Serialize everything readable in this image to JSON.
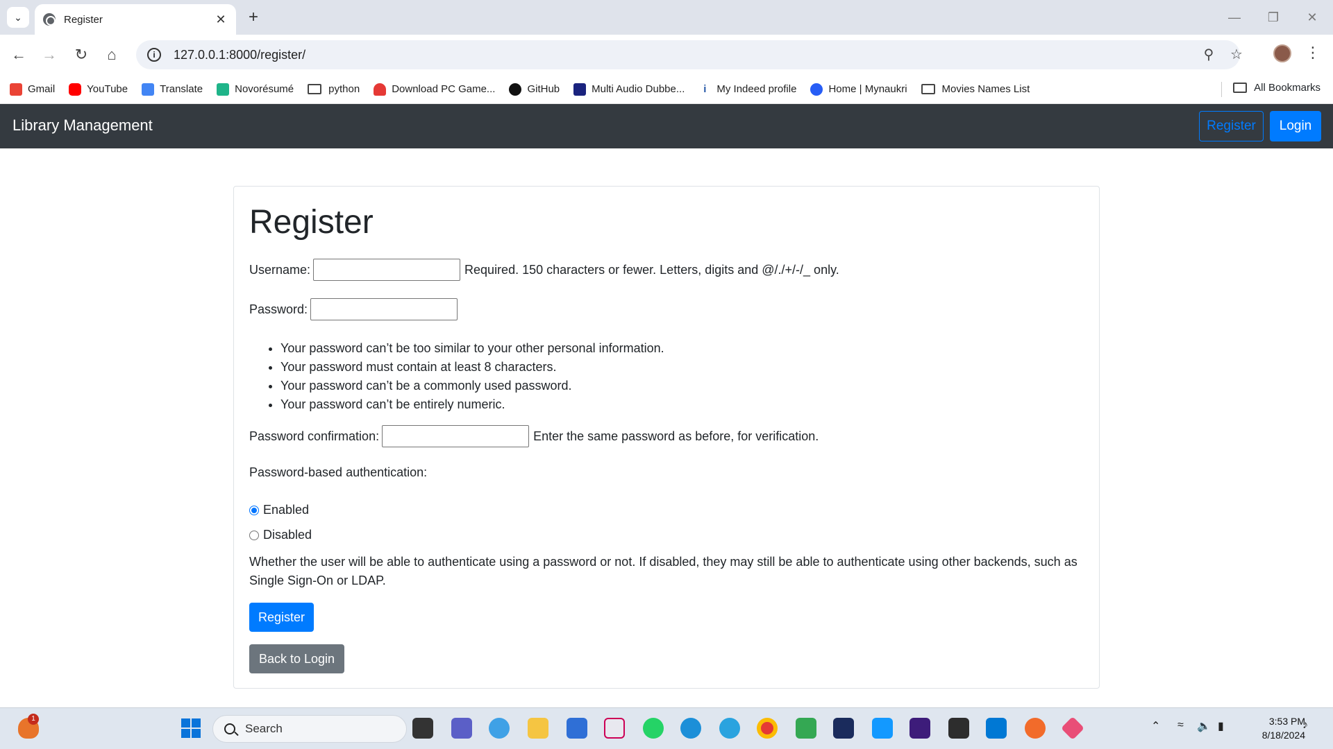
{
  "browser": {
    "tab_title": "Register",
    "url": "127.0.0.1:8000/register/",
    "bookmarks": [
      {
        "label": "Gmail",
        "icon": "gmail-icon",
        "color": "#ea4335"
      },
      {
        "label": "YouTube",
        "icon": "youtube-icon",
        "color": "#ff0000"
      },
      {
        "label": "Translate",
        "icon": "translate-icon",
        "color": "#4285f4"
      },
      {
        "label": "Novorésumé",
        "icon": "novoresume-icon",
        "color": "#1fb489"
      },
      {
        "label": "python",
        "icon": "folder-icon",
        "color": ""
      },
      {
        "label": "Download PC Game...",
        "icon": "game-icon",
        "color": "#e53935"
      },
      {
        "label": "GitHub",
        "icon": "github-icon",
        "color": "#111111"
      },
      {
        "label": "Multi Audio Dubbe...",
        "icon": "movie-icon",
        "color": "#1a237e"
      },
      {
        "label": "My Indeed profile",
        "icon": "indeed-icon",
        "color": "#2557a7"
      },
      {
        "label": "Home | Mynaukri",
        "icon": "naukri-icon",
        "color": "#275df5"
      },
      {
        "label": "Movies Names List",
        "icon": "folder-icon",
        "color": ""
      }
    ],
    "all_bookmarks_label": "All Bookmarks"
  },
  "navbar": {
    "brand": "Library Management",
    "register_label": "Register",
    "login_label": "Login"
  },
  "form": {
    "title": "Register",
    "username_label": "Username:",
    "username_help": "Required. 150 characters or fewer. Letters, digits and @/./+/-/_ only.",
    "password_label": "Password:",
    "password_rules": [
      "Your password can’t be too similar to your other personal information.",
      "Your password must contain at least 8 characters.",
      "Your password can’t be a commonly used password.",
      "Your password can’t be entirely numeric."
    ],
    "confirm_label": "Password confirmation:",
    "confirm_help": "Enter the same password as before, for verification.",
    "auth_label": "Password-based authentication:",
    "auth_options": [
      {
        "label": "Enabled",
        "checked": true
      },
      {
        "label": "Disabled",
        "checked": false
      }
    ],
    "auth_description": "Whether the user will be able to authenticate using a password or not. If disabled, they may still be able to authenticate using other backends, such as Single Sign-On or LDAP.",
    "submit_label": "Register",
    "back_label": "Back to Login"
  },
  "taskbar": {
    "search_placeholder": "Search",
    "notification_count": "1",
    "time": "3:53 PM",
    "date": "8/18/2024"
  },
  "colors": {
    "navbar_bg": "#343a40",
    "primary": "#007bff",
    "secondary": "#6c757d"
  }
}
